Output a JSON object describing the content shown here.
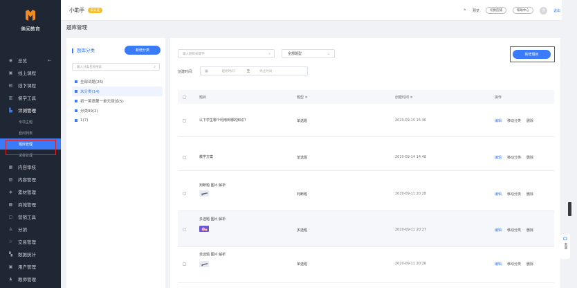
{
  "brand": {
    "name": "美闻教育",
    "logo_icon": "brand-logo-icon",
    "color": "#f08b1f"
  },
  "header": {
    "app_name": "小助手",
    "badge": "未认证",
    "actions": {
      "preview": "预览",
      "switch_store": "切换店铺",
      "help": "帮助中心",
      "logout": "退出"
    }
  },
  "sidebar": {
    "items": [
      {
        "label": "总览",
        "icon": "dashboard-icon"
      },
      {
        "label": "线上课程",
        "icon": "video-icon"
      },
      {
        "label": "线下课程",
        "icon": "classroom-icon"
      },
      {
        "label": "督学工具",
        "icon": "tools-icon"
      },
      {
        "label": "评测管理",
        "icon": "exam-icon"
      },
      {
        "label": "内容审核",
        "icon": "review-icon"
      },
      {
        "label": "内容管理",
        "icon": "content-icon"
      },
      {
        "label": "素材管理",
        "icon": "material-icon"
      },
      {
        "label": "商城管理",
        "icon": "shop-icon"
      },
      {
        "label": "营销工具",
        "icon": "marketing-icon"
      },
      {
        "label": "分销",
        "icon": "distribution-icon"
      },
      {
        "label": "交易管理",
        "icon": "trade-icon"
      },
      {
        "label": "数据统计",
        "icon": "stats-icon"
      },
      {
        "label": "用户管理",
        "icon": "user-icon"
      },
      {
        "label": "教师管理",
        "icon": "teacher-icon"
      }
    ],
    "sub_items": [
      "专项主题",
      "套间列表",
      "题库管理",
      "试卷管理"
    ],
    "active_sub": "题库管理"
  },
  "page": {
    "title": "题库管理"
  },
  "category_panel": {
    "title": "题库分类",
    "add_button": "新增分类",
    "search_placeholder": "输入分类名称搜索",
    "items": [
      "全部试题(26)",
      "未分类(14)",
      "初一英语第一单元测试(5)",
      "分类99(2)",
      "1(7)"
    ],
    "selected": "未分类(14)"
  },
  "filters": {
    "search_placeholder": "输入题目关键字",
    "type_select": "全部题型",
    "date_label": "创建时间:",
    "start_placeholder": "起始时间",
    "to": "至",
    "end_placeholder": "终止时间",
    "add_button": "新增题目"
  },
  "table": {
    "headers": {
      "title": "题目",
      "type": "题型 ≑",
      "time": "创建时间 ≑",
      "op": "操作"
    },
    "actions": {
      "edit": "编辑",
      "move": "移动分类",
      "delete": "删除"
    },
    "rows": [
      {
        "title": "以下学生哪个利用到哪的知识?",
        "type": "单选题",
        "time": "2020-09-15 15:36"
      },
      {
        "title": "教学方案",
        "type": "单选题",
        "time": "2020-09-14 14:48"
      },
      {
        "title": "判断题 图片 解析",
        "type": "判断题",
        "time": "2020-09-11 20:28"
      },
      {
        "title": "多选题 图片 解析",
        "type": "多选题",
        "time": "2020-09-11 20:27"
      },
      {
        "title": "单选题 图片 解析",
        "type": "单选题",
        "time": "2020-09-11 20:26"
      }
    ]
  },
  "help_float": {
    "label": "客服"
  },
  "colors": {
    "primary": "#3a7bfa",
    "sidebar": "#1f2734",
    "highlight": "#e02020"
  }
}
